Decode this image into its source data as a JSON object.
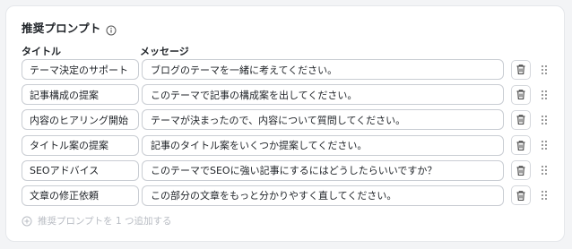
{
  "section": {
    "title": "推奨プロンプト",
    "info_icon": "info-circle-icon"
  },
  "columns": {
    "title": "タイトル",
    "message": "メッセージ"
  },
  "prompts": [
    {
      "title": "テーマ決定のサポート",
      "message": "ブログのテーマを一緒に考えてください。"
    },
    {
      "title": "記事構成の提案",
      "message": "このテーマで記事の構成案を出してください。"
    },
    {
      "title": "内容のヒアリング開始",
      "message": "テーマが決まったので、内容について質問してください。"
    },
    {
      "title": "タイトル案の提案",
      "message": "記事のタイトル案をいくつか提案してください。"
    },
    {
      "title": "SEOアドバイス",
      "message": "このテーマでSEOに強い記事にするにはどうしたらいいですか？"
    },
    {
      "title": "文章の修正依頼",
      "message": "この部分の文章をもっと分かりやすく直してください。"
    }
  ],
  "actions": {
    "add_label": "推奨プロンプトを 1 つ追加する",
    "delete_icon": "trash-icon",
    "drag_icon": "drag-handle-icon"
  },
  "colors": {
    "border": "#c9cdd3",
    "muted": "#b8bcc3",
    "text": "#1f2328"
  }
}
